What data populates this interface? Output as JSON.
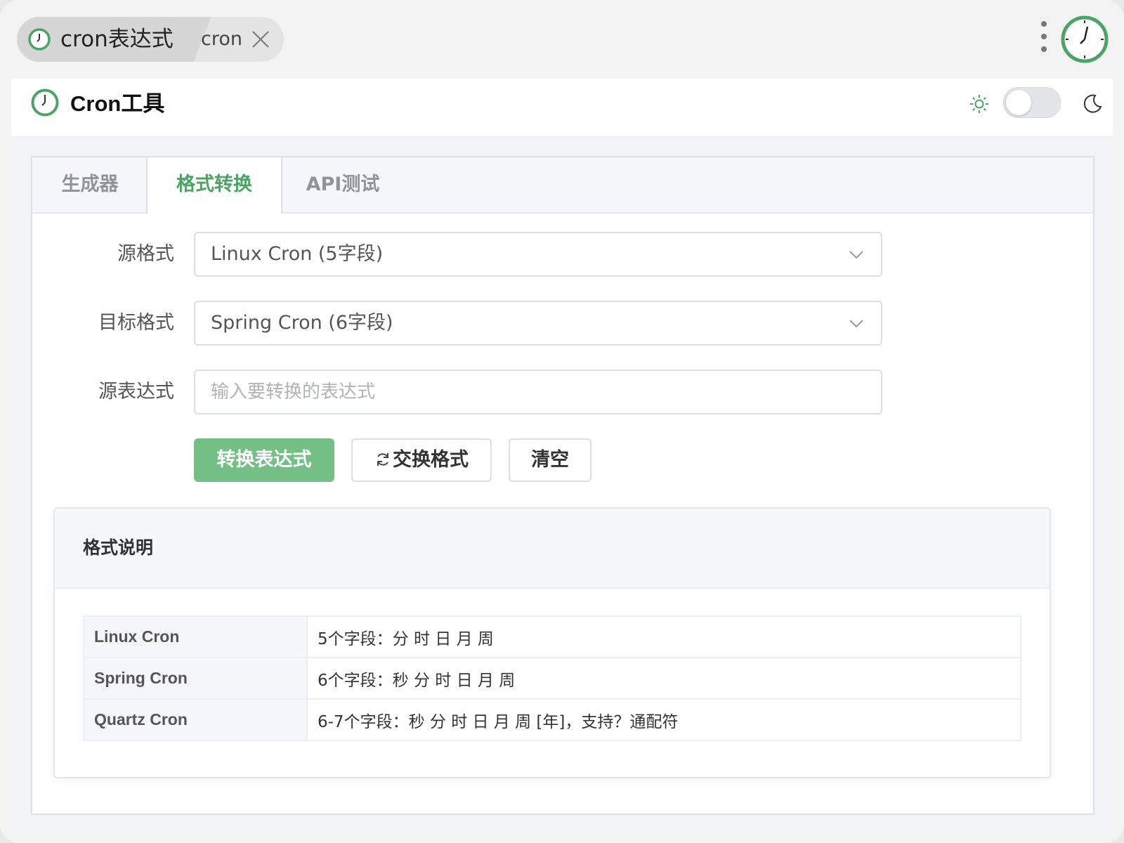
{
  "window": {
    "breadcrumb": {
      "title": "cron表达式",
      "sub": "cron"
    }
  },
  "header": {
    "title": "Cron工具"
  },
  "tabs": [
    {
      "label": "生成器",
      "active": false
    },
    {
      "label": "格式转换",
      "active": true
    },
    {
      "label": "API测试",
      "active": false
    }
  ],
  "form": {
    "source_format": {
      "label": "源格式",
      "value": "Linux Cron (5字段)"
    },
    "target_format": {
      "label": "目标格式",
      "value": "Spring Cron (6字段)"
    },
    "source_expression": {
      "label": "源表达式",
      "value": "",
      "placeholder": "输入要转换的表达式"
    }
  },
  "buttons": {
    "convert": "转换表达式",
    "swap": "交换格式",
    "clear": "清空"
  },
  "info": {
    "title": "格式说明",
    "rows": [
      {
        "name": "Linux Cron",
        "desc": "5个字段：分 时 日 月 周"
      },
      {
        "name": "Spring Cron",
        "desc": "6个字段：秒 分 时 日 月 周"
      },
      {
        "name": "Quartz Cron",
        "desc": "6-7个字段：秒 分 时 日 月 周 [年]，支持？通配符"
      }
    ]
  },
  "colors": {
    "accent": "#4aa564",
    "primary_button": "#73bf86",
    "border": "#dcdfe6"
  },
  "icons": {
    "app": "clock-icon",
    "theme_light": "sun-icon",
    "theme_dark": "moon-icon",
    "dropdown": "chevron-down-icon",
    "swap": "refresh-icon"
  },
  "theme_toggle": {
    "dark_mode": false
  }
}
